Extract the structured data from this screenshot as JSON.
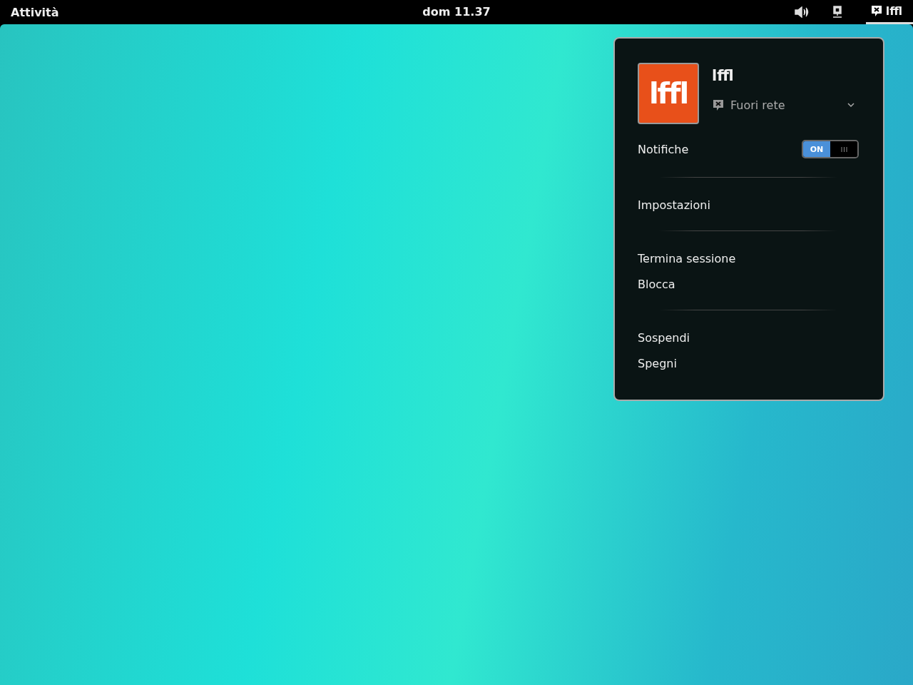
{
  "top_bar": {
    "activities": "Attività",
    "clock": "dom 11.37",
    "user_label": "lffl"
  },
  "user_menu": {
    "avatar_text": "lffl",
    "user_name": "lffl",
    "status": "Fuori rete",
    "notifications": {
      "label": "Notifiche",
      "switch_text": "ON",
      "on": true
    },
    "sections": [
      [
        {
          "label": "Impostazioni"
        }
      ],
      [
        {
          "label": "Termina sessione"
        },
        {
          "label": "Blocca"
        }
      ],
      [
        {
          "label": "Sospendi"
        },
        {
          "label": "Spegni"
        }
      ]
    ]
  }
}
